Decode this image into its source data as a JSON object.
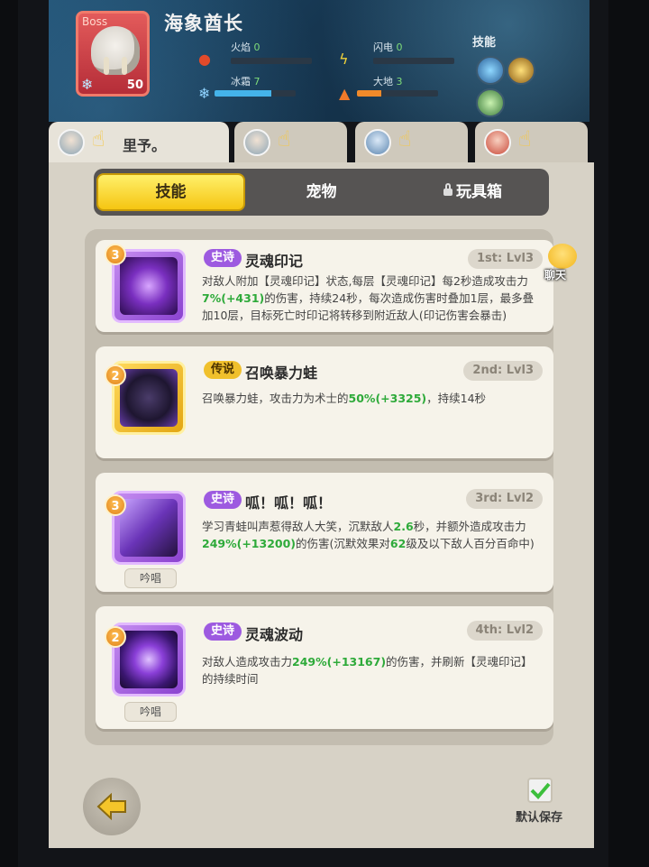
{
  "boss": {
    "tag": "Boss",
    "name": "海象酋长",
    "level": "50",
    "stats": {
      "fire": {
        "label": "火焰",
        "value": "0"
      },
      "lightning": {
        "label": "闪电",
        "value": "0"
      },
      "frost": {
        "label": "冰霜",
        "value": "7",
        "fill": 0.7
      },
      "earth": {
        "label": "大地",
        "value": "3",
        "fill": 0.3
      }
    },
    "skills_label": "技能"
  },
  "hero_tabs": [
    {
      "name": "里予。",
      "active": true
    },
    {
      "name": "",
      "active": false
    },
    {
      "name": "",
      "active": false
    },
    {
      "name": "",
      "active": false
    }
  ],
  "category_tabs": [
    {
      "label": "技能",
      "active": true
    },
    {
      "label": "宠物",
      "active": false
    },
    {
      "label": "玩具箱",
      "active": false,
      "locked": true
    }
  ],
  "chat_label": "聊天",
  "skills": [
    {
      "stars": "3",
      "rarity": "史诗",
      "title": "灵魂印记",
      "slot": "1st: Lvl3",
      "desc_parts": [
        "对敌人附加【灵魂印记】状态,每层【灵魂印记】每2秒造成攻击力",
        "7%",
        "(+431)",
        "的伤害，持续24秒，每次造成伤害时叠加1层，最多叠加10层，目标死亡时印记将转移到附近敌人(印记伤害会暴击)"
      ]
    },
    {
      "stars": "2",
      "rarity": "传说",
      "title": "召唤暴力蛙",
      "slot": "2nd: Lvl3",
      "desc_parts": [
        "召唤暴力蛙，攻击力为术士的",
        "50%",
        "(+3325)",
        "，持续14秒"
      ]
    },
    {
      "stars": "3",
      "rarity": "史诗",
      "title": "呱！呱！呱！",
      "slot": "3rd: Lvl2",
      "cast": "吟唱",
      "desc_parts": [
        "学习青蛙叫声惹得敌人大笑，沉默敌人",
        "2.6",
        "秒，并额外造成攻击力",
        "249%",
        "(+13200)",
        "的伤害(沉默效果对",
        "62",
        "级及以下敌人百分百命中)"
      ]
    },
    {
      "stars": "2",
      "rarity": "史诗",
      "title": "灵魂波动",
      "slot": "4th: Lvl2",
      "cast": "吟唱",
      "desc_parts": [
        "对敌人造成攻击力",
        "249%",
        "(+13167)",
        "的伤害，并刷新【灵魂印记】的持续时间"
      ]
    }
  ],
  "footer": {
    "save_label": "默认保存"
  }
}
